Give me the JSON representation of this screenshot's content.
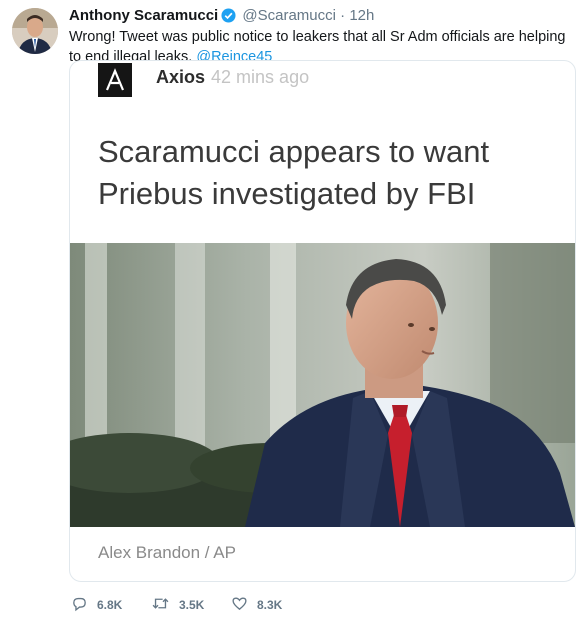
{
  "tweet": {
    "display_name": "Anthony Scaramucci",
    "handle": "@Scaramucci",
    "separator": "·",
    "time": "12h",
    "text_main": "Wrong! Tweet was public notice to leakers that all Sr Adm officials are helping to end illegal leaks.",
    "mention": "@Reince45"
  },
  "card": {
    "source": "Axios",
    "age": "42 mins ago",
    "headline": "Scaramucci appears to want Priebus investigated by FBI",
    "photo_credit": "Alex Brandon / AP"
  },
  "actions": {
    "replies": "6.8K",
    "retweets": "3.5K",
    "likes": "8.3K"
  },
  "colors": {
    "link": "#1b95e0",
    "verified": "#1da1f2",
    "muted": "#657786"
  },
  "icons": [
    "verified-badge-icon",
    "reply-icon",
    "retweet-icon",
    "like-icon",
    "axios-logo"
  ]
}
